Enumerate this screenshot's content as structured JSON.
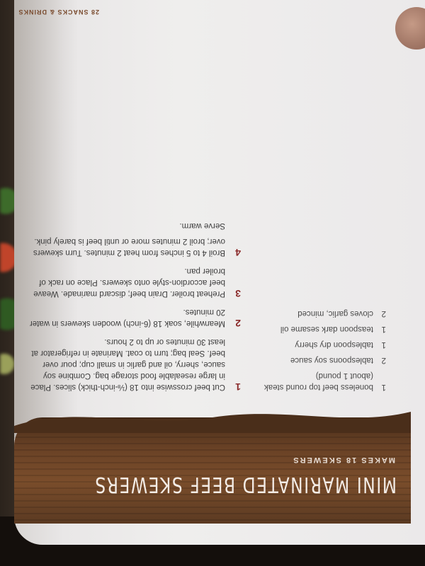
{
  "page_header": "28  SNACKS & DRINKS",
  "recipe": {
    "title": "MINI MARINATED BEEF SKEWERS",
    "yield": "MAKES 18 SKEWERS",
    "ingredients": [
      {
        "qty": "1",
        "item": "boneless beef top round steak (about 1 pound)"
      },
      {
        "qty": "2",
        "item": "tablespoons soy sauce"
      },
      {
        "qty": "1",
        "item": "tablespoon dry sherry"
      },
      {
        "qty": "1",
        "item": "teaspoon dark sesame oil"
      },
      {
        "qty": "2",
        "item": "cloves garlic, minced"
      }
    ],
    "steps": [
      {
        "num": "1",
        "text": "Cut beef crosswise into 18 (⅛-inch-thick) slices. Place in large resealable food storage bag. Combine soy sauce, sherry, oil and garlic in small cup; pour over beef. Seal bag; turn to coat. Marinate in refrigerator at least 30 minutes or up to 2 hours."
      },
      {
        "num": "2",
        "text": "Meanwhile, soak 18 (6-inch) wooden skewers in water 20 minutes."
      },
      {
        "num": "3",
        "text": "Preheat broiler. Drain beef; discard marinade. Weave beef accordion-style onto skewers. Place on rack of broiler pan."
      },
      {
        "num": "4",
        "text": "Broil 4 to 5 inches from heat 2 minutes. Turn skewers over; broil 2 minutes more or until beef is barely pink."
      }
    ],
    "serve": "Serve warm."
  }
}
